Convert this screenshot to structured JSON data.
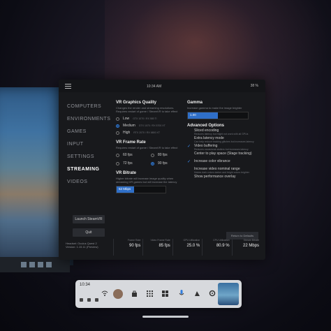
{
  "topbar": {
    "time": "10:34 AM",
    "battery": "38 %"
  },
  "sidebar": {
    "items": [
      {
        "label": "COMPUTERS"
      },
      {
        "label": "ENVIRONMENTS"
      },
      {
        "label": "GAMES"
      },
      {
        "label": "INPUT"
      },
      {
        "label": "SETTINGS"
      },
      {
        "label": "STREAMING"
      },
      {
        "label": "VIDEOS"
      }
    ],
    "launch_label": "Launch SteamVR",
    "quit_label": "Quit"
  },
  "graphics": {
    "title": "VR Graphics Quality",
    "desc": "Changes the render and streaming resolutions. Requires restart of game / SteamVR to take effect",
    "options": [
      {
        "label": "Low",
        "hint": "GTX 1070 / RX 580 Ti"
      },
      {
        "label": "Medium",
        "hint": "GTX 1070 / RX 5700 XT"
      },
      {
        "label": "High",
        "hint": "RTX 2070 / RX 6800 XT"
      }
    ],
    "selected": "Medium"
  },
  "framerate": {
    "title": "VR Frame Rate",
    "desc": "Requires restart of game / SteamVR to take effect",
    "options": [
      "60 fps",
      "80 fps",
      "72 fps",
      "90 fps"
    ],
    "selected": "90 fps"
  },
  "bitrate": {
    "title": "VR Bitrate",
    "desc": "Higher bitrate will increase image quality when streaming VR games but will increase the latency",
    "value": "52 Mbps",
    "level_fraction": 0.35
  },
  "gamma": {
    "title": "Gamma",
    "desc": "Increase gamma to make the image brighter",
    "value": "1.00",
    "level_fraction": 0.5
  },
  "advanced": {
    "title": "Advanced Options",
    "items": [
      {
        "label": "Sliced encoding",
        "sub": "Reduces latency but might not work with all GPUs",
        "checked": false
      },
      {
        "label": "Extra latency mode",
        "sub": "Can help reduce tracking glitches but increases latency",
        "checked": false
      },
      {
        "label": "Video buffering",
        "sub": "Reduces occasional stutters but increases latency",
        "checked": true
      },
      {
        "label": "Center to play space (Stage tracking)",
        "sub": "",
        "checked": false
      },
      {
        "label": "Increase color vibrance",
        "sub": "",
        "checked": true
      },
      {
        "label": "Increase video nominal range",
        "sub": "Makes dark colors darker and bright colors brighter",
        "checked": false
      },
      {
        "label": "Show performance overlay",
        "sub": "",
        "checked": false
      }
    ]
  },
  "return_label": "Return to Defaults",
  "device": {
    "headset_label": "Headset",
    "headset_value": "Oculus Quest 2",
    "version_label": "Version",
    "version_value": "1.15.11 (Preview)"
  },
  "stats": [
    {
      "label": "Frame Rate",
      "value": "90 fps"
    },
    {
      "label": "Video Frame Rate",
      "value": "85 fps"
    },
    {
      "label": "GPU Utilization",
      "value": "25.0 %"
    },
    {
      "label": "CPU Utilization",
      "value": "80.9 %"
    },
    {
      "label": "Stream Bitrate",
      "value": "22 Mbps"
    }
  ],
  "dock": {
    "time": "10:34"
  },
  "colors": {
    "accent": "#2f7dde",
    "panel": "#18191c",
    "dock": "#d7d9dd"
  },
  "icons": [
    "menu-icon",
    "wifi-icon",
    "avatar",
    "store-icon",
    "apps-icon",
    "mic-icon",
    "share-icon",
    "settings-icon"
  ]
}
